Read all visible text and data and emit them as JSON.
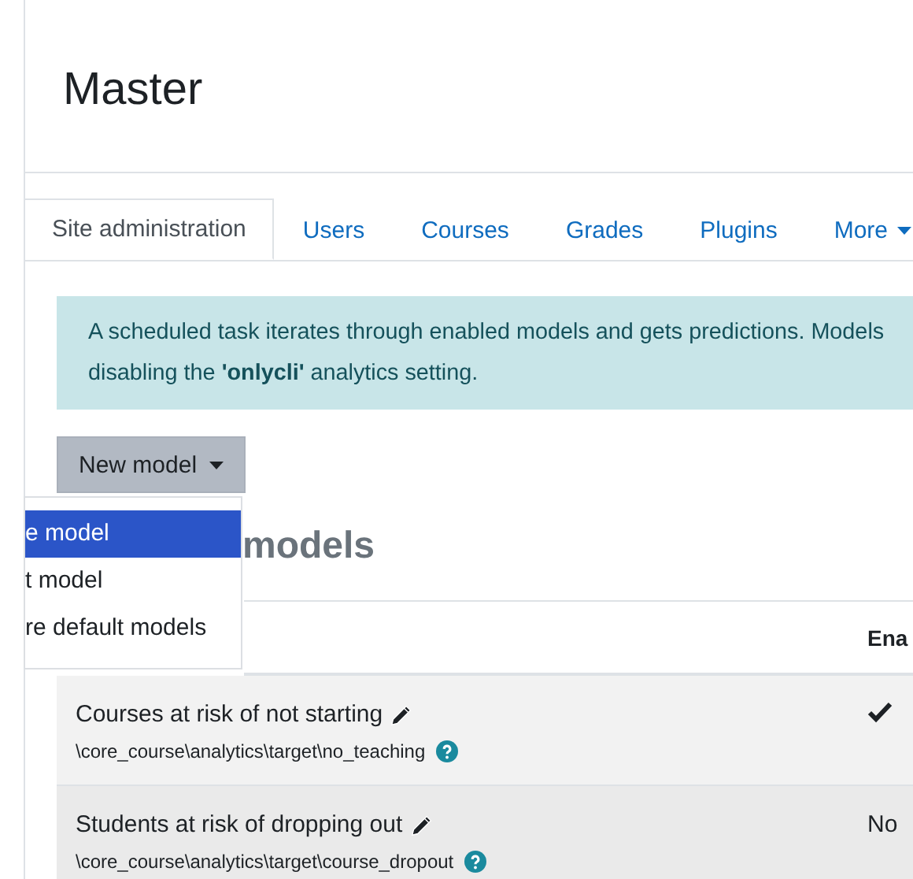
{
  "page": {
    "title": "Master"
  },
  "tabs": [
    {
      "label": "Site administration",
      "selected": true
    },
    {
      "label": "Users",
      "selected": false
    },
    {
      "label": "Courses",
      "selected": false
    },
    {
      "label": "Grades",
      "selected": false
    },
    {
      "label": "Plugins",
      "selected": false
    },
    {
      "label": "More",
      "selected": false,
      "has_caret": true
    }
  ],
  "alert": {
    "lines": [
      "A scheduled task iterates through enabled models and gets predictions. Models",
      "disabling the **'onlycli'** analytics setting."
    ]
  },
  "new_model_button": {
    "label": "New model",
    "expanded": true
  },
  "dropdown": {
    "items": [
      {
        "label": "e model",
        "selected": true
      },
      {
        "label": "t model",
        "selected": false
      },
      {
        "label": "re default models",
        "selected": false
      }
    ]
  },
  "heading": "models",
  "table": {
    "columns": [
      "Ena"
    ],
    "rows": [
      {
        "name": "Courses at risk of not starting",
        "target": "\\core_course\\analytics\\target\\no_teaching",
        "enabled": true
      },
      {
        "name": "Students at risk of dropping out",
        "target": "\\core_course\\analytics\\target\\course_dropout",
        "enabled": false,
        "enabled_label": "No"
      }
    ]
  }
}
